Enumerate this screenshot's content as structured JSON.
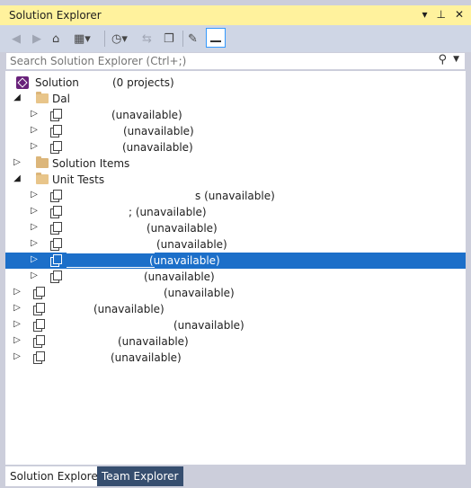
{
  "window": {
    "title": "Solution Explorer",
    "pin_label": "⊣",
    "dropdown_label": "▾",
    "close_label": ""
  },
  "toolbar": {
    "back_icon": "back-icon",
    "forward_icon": "forward-icon",
    "home_icon": "home-icon",
    "views_icon": "switch-views-icon",
    "history_icon": "pending-changes-filter-icon",
    "sync_icon": "sync-with-active-document-icon",
    "collapse_icon": "collapse-all-icon",
    "properties_icon": "properties-icon",
    "preview_icon": "preview-selected-items-icon"
  },
  "search": {
    "placeholder": "Search Solution Explorer (Ctrl+;)"
  },
  "tree": {
    "solution": {
      "label": "Solution",
      "detail": "(0 projects)"
    },
    "dal": {
      "label": "Dal"
    },
    "dal_items": [
      {
        "label": "(unavailable)"
      },
      {
        "label": "(unavailable)"
      },
      {
        "label": "(unavailable)"
      }
    ],
    "solution_items": {
      "label": "Solution Items"
    },
    "unit_tests": {
      "label": "Unit Tests"
    },
    "unit_test_items": [
      {
        "label": "s (unavailable)"
      },
      {
        "label": "; (unavailable)"
      },
      {
        "label": "(unavailable)"
      },
      {
        "label": "(unavailable)"
      },
      {
        "label": "(unavailable)"
      },
      {
        "label": "(unavailable)"
      }
    ],
    "root_projects": [
      {
        "label": "(unavailable)"
      },
      {
        "label": "(unavailable)"
      },
      {
        "label": "(unavailable)"
      },
      {
        "label": "(unavailable)"
      },
      {
        "label": "(unavailable)"
      }
    ]
  },
  "tabs": [
    {
      "label": "Solution Explorer",
      "active": true
    },
    {
      "label": "Team Explorer",
      "active": false
    }
  ],
  "colors": {
    "title_bar": "#fff29d",
    "selection": "#1c6fc9",
    "toolbar": "#cfd6e5",
    "tab_inactive": "#364e6f"
  }
}
